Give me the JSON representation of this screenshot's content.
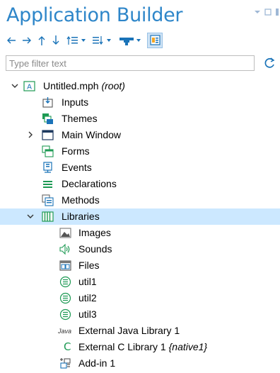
{
  "header": {
    "title": "Application Builder"
  },
  "filter": {
    "placeholder": "Type filter text"
  },
  "colors": {
    "accent": "#2e86c9",
    "selection": "#cce8ff",
    "icon_blue": "#1a73b8",
    "icon_green": "#1e9a54"
  },
  "tree": {
    "root": {
      "label": "Untitled.mph",
      "note": "(root)",
      "icon": "app-icon"
    },
    "items": [
      {
        "label": "Inputs",
        "icon": "inputs-icon"
      },
      {
        "label": "Themes",
        "icon": "themes-icon"
      },
      {
        "label": "Main Window",
        "icon": "window-icon"
      },
      {
        "label": "Forms",
        "icon": "forms-icon"
      },
      {
        "label": "Events",
        "icon": "events-icon"
      },
      {
        "label": "Declarations",
        "icon": "declarations-icon"
      },
      {
        "label": "Methods",
        "icon": "methods-icon"
      },
      {
        "label": "Libraries",
        "icon": "libraries-icon"
      }
    ],
    "library_items": [
      {
        "label": "Images",
        "icon": "images-icon"
      },
      {
        "label": "Sounds",
        "icon": "sounds-icon"
      },
      {
        "label": "Files",
        "icon": "files-icon"
      },
      {
        "label": "util1",
        "icon": "util-icon"
      },
      {
        "label": "util2",
        "icon": "util-icon"
      },
      {
        "label": "util3",
        "icon": "util-icon"
      },
      {
        "label": "External Java Library 1",
        "icon": "java-icon",
        "icon_text": "Java"
      },
      {
        "label": "External C Library 1",
        "note": "{native1}",
        "icon": "c-library-icon",
        "icon_text": "C"
      },
      {
        "label": "Add-in 1",
        "icon": "add-in-icon"
      }
    ]
  }
}
